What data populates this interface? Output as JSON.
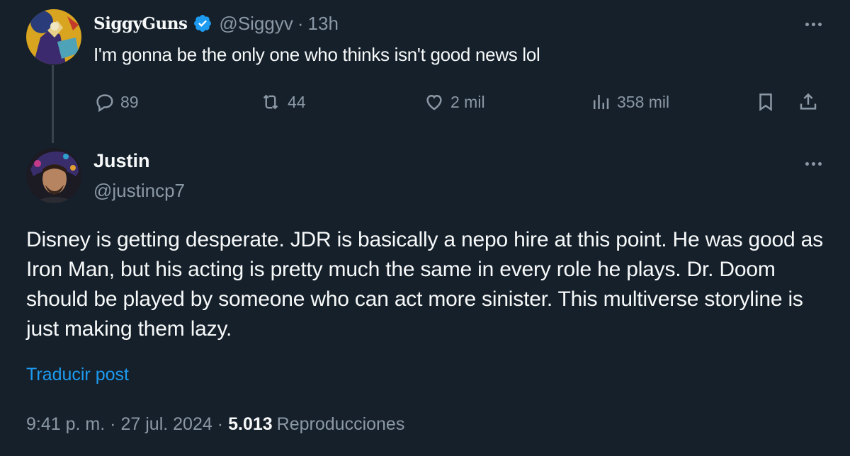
{
  "reply": {
    "display_name": "SiggyGuns",
    "handle": "@Siggyv",
    "separator": "·",
    "time": "13h",
    "text": "I'm gonna be the only one who thinks isn't good news lol",
    "actions": {
      "replies": "89",
      "reposts": "44",
      "likes": "2 mil",
      "views": "358 mil"
    }
  },
  "tweet": {
    "display_name": "Justin",
    "handle": "@justincp7",
    "text": "Disney is getting desperate. JDR is basically a nepo hire at this point. He was good as Iron Man, but his acting is pretty much the same in every role he plays. Dr. Doom should be played by someone who can act more sinister. This multiverse storyline is just making them lazy.",
    "translate_label": "Traducir post",
    "time": "9:41 p. m.",
    "date": "27 jul. 2024",
    "views_count": "5.013",
    "views_label": "Reproducciones"
  },
  "colors": {
    "background": "#15202b",
    "text": "#f7f9f9",
    "secondary": "#8b98a5",
    "accent": "#1d9bf0"
  }
}
